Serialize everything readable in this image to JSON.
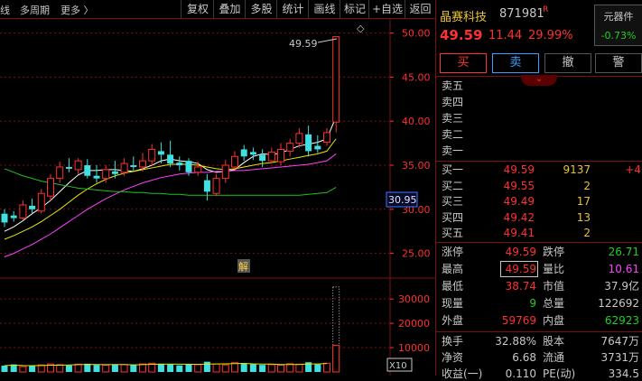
{
  "toolbar": {
    "left_items": [
      "线",
      "多周期",
      "更多 〉"
    ],
    "buttons": [
      "复权",
      "叠加",
      "多股",
      "统计",
      "画线",
      "标记",
      "+自选",
      "返回"
    ]
  },
  "chart": {
    "y_ticks": [
      "50.00",
      "45.00",
      "40.00",
      "35.00",
      "30.00",
      "25.00"
    ],
    "vol_ticks": [
      "30000",
      "20000",
      "10000"
    ],
    "vol_unit": "X10",
    "high_annotation": "49.59",
    "current_tag": "30.95",
    "marker_label": "解",
    "diamond_icon": "◇"
  },
  "chart_data": {
    "type": "candlestick",
    "y_range": [
      22.5,
      51.5
    ],
    "volume_range": [
      0,
      36000
    ],
    "candles": [
      {
        "o": 28.5,
        "c": 29.5,
        "h": 30.0,
        "l": 28.0,
        "up": false
      },
      {
        "o": 29.0,
        "c": 29.3,
        "h": 29.8,
        "l": 28.6,
        "up": false
      },
      {
        "o": 29.0,
        "c": 30.5,
        "h": 31.0,
        "l": 28.8,
        "up": true
      },
      {
        "o": 30.4,
        "c": 30.0,
        "h": 31.2,
        "l": 29.5,
        "up": false
      },
      {
        "o": 29.8,
        "c": 31.8,
        "h": 32.3,
        "l": 29.5,
        "up": true
      },
      {
        "o": 31.5,
        "c": 33.5,
        "h": 34.0,
        "l": 31.0,
        "up": true
      },
      {
        "o": 33.5,
        "c": 34.8,
        "h": 35.4,
        "l": 33.0,
        "up": true
      },
      {
        "o": 34.8,
        "c": 34.6,
        "h": 35.8,
        "l": 34.2,
        "up": false
      },
      {
        "o": 34.5,
        "c": 35.5,
        "h": 35.8,
        "l": 34.0,
        "up": true
      },
      {
        "o": 35.0,
        "c": 33.8,
        "h": 35.7,
        "l": 33.5,
        "up": false
      },
      {
        "o": 33.8,
        "c": 33.5,
        "h": 35.0,
        "l": 33.0,
        "up": false
      },
      {
        "o": 33.5,
        "c": 34.5,
        "h": 35.0,
        "l": 33.0,
        "up": true
      },
      {
        "o": 34.3,
        "c": 34.0,
        "h": 35.5,
        "l": 33.5,
        "up": false
      },
      {
        "o": 34.2,
        "c": 35.2,
        "h": 35.8,
        "l": 33.8,
        "up": true
      },
      {
        "o": 35.0,
        "c": 34.8,
        "h": 36.0,
        "l": 34.4,
        "up": false
      },
      {
        "o": 34.8,
        "c": 35.5,
        "h": 36.4,
        "l": 34.3,
        "up": true
      },
      {
        "o": 35.5,
        "c": 36.8,
        "h": 37.4,
        "l": 35.0,
        "up": true
      },
      {
        "o": 36.6,
        "c": 36.2,
        "h": 37.6,
        "l": 35.2,
        "up": false
      },
      {
        "o": 36.2,
        "c": 35.2,
        "h": 37.8,
        "l": 34.8,
        "up": false
      },
      {
        "o": 35.0,
        "c": 35.3,
        "h": 36.0,
        "l": 34.4,
        "up": false
      },
      {
        "o": 35.5,
        "c": 34.2,
        "h": 35.8,
        "l": 33.8,
        "up": false
      },
      {
        "o": 34.2,
        "c": 34.8,
        "h": 35.4,
        "l": 33.8,
        "up": true
      },
      {
        "o": 33.3,
        "c": 32.0,
        "h": 34.0,
        "l": 31.0,
        "up": false
      },
      {
        "o": 31.8,
        "c": 33.5,
        "h": 34.0,
        "l": 31.5,
        "up": true
      },
      {
        "o": 33.5,
        "c": 35.0,
        "h": 35.6,
        "l": 33.0,
        "up": true
      },
      {
        "o": 34.8,
        "c": 36.0,
        "h": 36.6,
        "l": 34.5,
        "up": true
      },
      {
        "o": 36.0,
        "c": 36.8,
        "h": 37.3,
        "l": 35.5,
        "up": false
      },
      {
        "o": 36.5,
        "c": 36.2,
        "h": 37.0,
        "l": 35.6,
        "up": false
      },
      {
        "o": 36.2,
        "c": 35.5,
        "h": 36.8,
        "l": 34.8,
        "up": false
      },
      {
        "o": 35.5,
        "c": 36.5,
        "h": 37.0,
        "l": 35.2,
        "up": true
      },
      {
        "o": 35.4,
        "c": 36.8,
        "h": 37.5,
        "l": 35.0,
        "up": true
      },
      {
        "o": 36.6,
        "c": 37.5,
        "h": 38.0,
        "l": 36.0,
        "up": true
      },
      {
        "o": 37.5,
        "c": 38.6,
        "h": 39.2,
        "l": 37.0,
        "up": true
      },
      {
        "o": 38.5,
        "c": 36.6,
        "h": 39.5,
        "l": 36.0,
        "up": false
      },
      {
        "o": 36.8,
        "c": 37.2,
        "h": 38.4,
        "l": 36.4,
        "up": false
      },
      {
        "o": 37.6,
        "c": 38.7,
        "h": 39.2,
        "l": 37.2,
        "up": true
      },
      {
        "o": 39.9,
        "c": 49.59,
        "h": 49.59,
        "l": 38.74,
        "up": true
      }
    ],
    "volumes": [
      2600,
      3100,
      2200,
      2500,
      2900,
      3300,
      3000,
      2700,
      3200,
      3400,
      2900,
      2800,
      3100,
      3000,
      2800,
      3300,
      3600,
      3400,
      3100,
      2700,
      3300,
      3000,
      4200,
      3300,
      2900,
      3800,
      3400,
      3200,
      2900,
      3000,
      2800,
      3400,
      3200,
      4000,
      3100,
      3600,
      35000
    ],
    "ma_lines": [
      {
        "name": "MA5",
        "color": "#ffffff",
        "values": [
          27.5,
          28.0,
          28.7,
          29.5,
          30.2,
          31.0,
          32.0,
          33.0,
          33.9,
          34.4,
          34.4,
          34.5,
          34.5,
          34.4,
          34.3,
          34.6,
          35.0,
          35.5,
          35.7,
          35.5,
          35.4,
          35.2,
          34.5,
          34.2,
          34.3,
          34.5,
          35.3,
          36.0,
          36.3,
          36.2,
          36.4,
          36.8,
          37.2,
          37.4,
          37.6,
          38.0,
          40.5
        ]
      },
      {
        "name": "MA10",
        "color": "#e8e800",
        "values": [
          26.6,
          27.0,
          27.5,
          28.0,
          28.6,
          29.3,
          30.0,
          30.8,
          31.6,
          32.3,
          32.9,
          33.4,
          33.8,
          34.1,
          34.3,
          34.5,
          34.7,
          34.9,
          35.1,
          35.1,
          35.1,
          35.0,
          34.8,
          34.6,
          34.5,
          34.6,
          34.8,
          35.0,
          35.2,
          35.3,
          35.5,
          35.7,
          35.9,
          36.1,
          36.3,
          36.6,
          38.0
        ]
      },
      {
        "name": "MA20",
        "color": "#ff40ff",
        "values": [
          24.6,
          25.0,
          25.5,
          26.0,
          26.6,
          27.2,
          27.9,
          28.6,
          29.3,
          30.0,
          30.6,
          31.2,
          31.7,
          32.2,
          32.6,
          33.0,
          33.3,
          33.6,
          33.8,
          34.0,
          34.1,
          34.2,
          34.2,
          34.3,
          34.3,
          34.4,
          34.4,
          34.5,
          34.6,
          34.7,
          34.8,
          34.9,
          35.0,
          35.1,
          35.3,
          35.5,
          36.3
        ]
      },
      {
        "name": "MA60",
        "color": "#20c020",
        "values": [
          34.6,
          34.2,
          33.8,
          33.5,
          33.2,
          33.0,
          32.8,
          32.6,
          32.4,
          32.3,
          32.2,
          32.1,
          32.0,
          32.0,
          31.9,
          31.9,
          31.8,
          31.8,
          31.7,
          31.7,
          31.6,
          31.6,
          31.6,
          31.6,
          31.6,
          31.6,
          31.6,
          31.6,
          31.6,
          31.6,
          31.6,
          31.6,
          31.6,
          31.7,
          31.8,
          31.9,
          32.5
        ]
      }
    ]
  },
  "stock": {
    "name": "晶赛科技",
    "code": "871981",
    "flag": "R",
    "price": "49.59",
    "change": "11.44",
    "pct": "29.99%",
    "sector_name": "元器件",
    "sector_pct": "-0.73%"
  },
  "actions": {
    "buy": "买",
    "sell": "卖",
    "cancel": "撤",
    "alert": "警"
  },
  "expand_icon": "⌄",
  "order_book": {
    "asks": [
      {
        "label": "卖五",
        "price": "",
        "vol": "",
        "delta": ""
      },
      {
        "label": "卖四",
        "price": "",
        "vol": "",
        "delta": ""
      },
      {
        "label": "卖三",
        "price": "",
        "vol": "",
        "delta": ""
      },
      {
        "label": "卖二",
        "price": "",
        "vol": "",
        "delta": ""
      },
      {
        "label": "卖一",
        "price": "",
        "vol": "",
        "delta": ""
      }
    ],
    "bids": [
      {
        "label": "买一",
        "price": "49.59",
        "vol": "9137",
        "delta": "+4"
      },
      {
        "label": "买二",
        "price": "49.55",
        "vol": "2",
        "delta": ""
      },
      {
        "label": "买三",
        "price": "49.49",
        "vol": "17",
        "delta": ""
      },
      {
        "label": "买四",
        "price": "49.42",
        "vol": "13",
        "delta": ""
      },
      {
        "label": "买五",
        "price": "49.41",
        "vol": "2",
        "delta": ""
      }
    ]
  },
  "stats": [
    {
      "l1": "涨停",
      "v1": "49.59",
      "c1": "#ff3030",
      "l2": "跌停",
      "v2": "26.71",
      "c2": "#20d020"
    },
    {
      "l1": "最高",
      "v1": "49.59",
      "c1": "#ff3030",
      "l2": "量比",
      "v2": "10.61",
      "c2": "#ff40ff"
    },
    {
      "l1": "最低",
      "v1": "38.74",
      "c1": "#ff3030",
      "l2": "市值",
      "v2": "37.9亿",
      "c2": "#c8c8c8"
    },
    {
      "l1": "现量",
      "v1": "9",
      "c1": "#20d020",
      "l2": "总量",
      "v2": "122692",
      "c2": "#c8c8c8"
    },
    {
      "l1": "外盘",
      "v1": "59769",
      "c1": "#ff3030",
      "l2": "内盘",
      "v2": "62923",
      "c2": "#20d020"
    },
    {
      "l1": "换手",
      "v1": "32.88%",
      "c1": "#c8c8c8",
      "l2": "股本",
      "v2": "7647万",
      "c2": "#c8c8c8"
    },
    {
      "l1": "净资",
      "v1": "6.68",
      "c1": "#c8c8c8",
      "l2": "流通",
      "v2": "3731万",
      "c2": "#c8c8c8"
    },
    {
      "l1": "收益(一)",
      "v1": "0.110",
      "c1": "#c8c8c8",
      "l2": "PE(动)",
      "v2": "334.5",
      "c2": "#c8c8c8"
    }
  ]
}
